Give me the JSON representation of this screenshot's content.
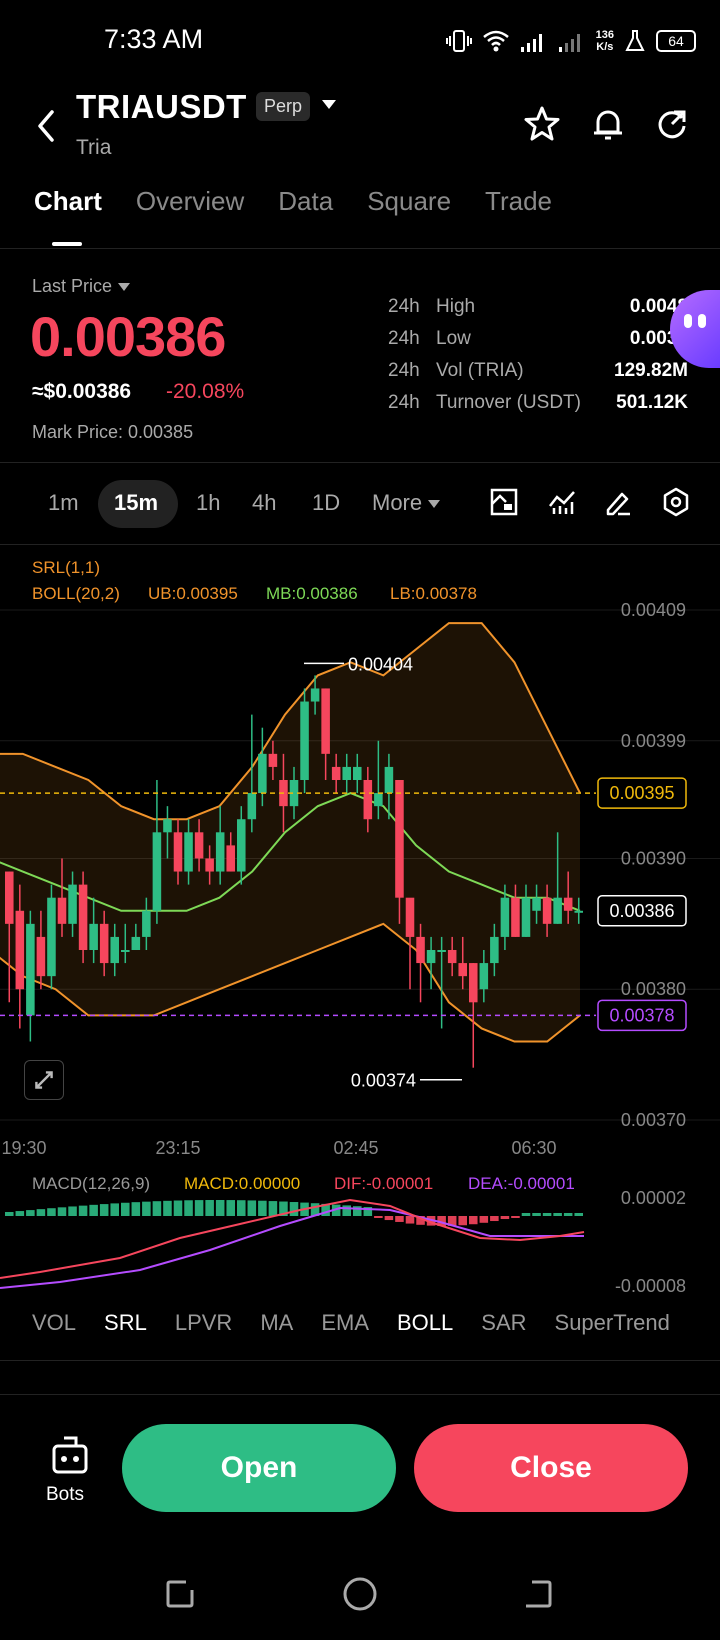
{
  "status": {
    "time": "7:33 AM",
    "net_speed_value": "136",
    "net_speed_unit": "K/s",
    "battery": "64"
  },
  "header": {
    "symbol": "TRIAUSDT",
    "badge": "Perp",
    "name": "Tria"
  },
  "tabs": [
    "Chart",
    "Overview",
    "Data",
    "Square",
    "Trade"
  ],
  "price": {
    "label": "Last Price",
    "last": "0.00386",
    "usd": "≈$0.00386",
    "change": "-20.08%",
    "mark": "Mark Price: 0.00385"
  },
  "stats": [
    {
      "period": "24h",
      "label": "High",
      "value": "0.0048"
    },
    {
      "period": "24h",
      "label": "Low",
      "value": "0.0037"
    },
    {
      "period": "24h",
      "label": "Vol (TRIA)",
      "value": "129.82M"
    },
    {
      "period": "24h",
      "label": "Turnover (USDT)",
      "value": "501.12K"
    }
  ],
  "timeframes": [
    "1m",
    "15m",
    "1h",
    "4h",
    "1D",
    "More"
  ],
  "indicators": {
    "srl": "SRL(1,1)",
    "boll": "BOLL(20,2)",
    "ub": "UB:0.00395",
    "mb": "MB:0.00386",
    "lb": "LB:0.00378",
    "macd_title": "MACD(12,26,9)",
    "macd_val": "MACD:0.00000",
    "dif": "DIF:-0.00001",
    "dea": "DEA:-0.00001"
  },
  "chart_data": {
    "type": "candlestick",
    "y_ticks": [
      "0.00409",
      "0.00399",
      "0.00390",
      "0.00380",
      "0.00370"
    ],
    "x_ticks": [
      "19:30",
      "23:15",
      "02:45",
      "06:30"
    ],
    "high_label": "0.00404",
    "low_label": "0.00374",
    "ub_tag": "0.00395",
    "current_tag": "0.00386",
    "lb_tag": "0.00378",
    "macd_ticks": [
      "0.00002",
      "-0.00008"
    ],
    "candles": [
      [
        0.00389,
        0.00385,
        0.00389,
        0.00379
      ],
      [
        0.00386,
        0.0038,
        0.00388,
        0.00377
      ],
      [
        0.00378,
        0.00385,
        0.00386,
        0.00376
      ],
      [
        0.00384,
        0.00381,
        0.00386,
        0.0038
      ],
      [
        0.00381,
        0.00387,
        0.00388,
        0.0038
      ],
      [
        0.00387,
        0.00385,
        0.0039,
        0.00384
      ],
      [
        0.00385,
        0.00388,
        0.00389,
        0.00384
      ],
      [
        0.00388,
        0.00383,
        0.00389,
        0.00382
      ],
      [
        0.00383,
        0.00385,
        0.00387,
        0.00382
      ],
      [
        0.00385,
        0.00382,
        0.00386,
        0.00381
      ],
      [
        0.00382,
        0.00384,
        0.00385,
        0.00381
      ],
      [
        0.00383,
        0.00383,
        0.00385,
        0.00382
      ],
      [
        0.00383,
        0.00384,
        0.00385,
        0.00383
      ],
      [
        0.00384,
        0.00386,
        0.00387,
        0.00383
      ],
      [
        0.00386,
        0.00392,
        0.00396,
        0.00385
      ],
      [
        0.00392,
        0.00393,
        0.00394,
        0.0039
      ],
      [
        0.00392,
        0.00389,
        0.00393,
        0.00388
      ],
      [
        0.00389,
        0.00392,
        0.00393,
        0.00388
      ],
      [
        0.00392,
        0.0039,
        0.00393,
        0.00389
      ],
      [
        0.0039,
        0.00389,
        0.00391,
        0.00388
      ],
      [
        0.00389,
        0.00392,
        0.00394,
        0.00388
      ],
      [
        0.00391,
        0.00389,
        0.00392,
        0.00389
      ],
      [
        0.00389,
        0.00393,
        0.00394,
        0.00388
      ],
      [
        0.00393,
        0.00395,
        0.00401,
        0.00392
      ],
      [
        0.00395,
        0.00398,
        0.004,
        0.00394
      ],
      [
        0.00398,
        0.00397,
        0.00399,
        0.00396
      ],
      [
        0.00396,
        0.00394,
        0.00398,
        0.00392
      ],
      [
        0.00394,
        0.00396,
        0.00397,
        0.00393
      ],
      [
        0.00396,
        0.00402,
        0.00403,
        0.00395
      ],
      [
        0.00402,
        0.00403,
        0.00404,
        0.00401
      ],
      [
        0.00403,
        0.00398,
        0.00403,
        0.00396
      ],
      [
        0.00397,
        0.00396,
        0.00398,
        0.00395
      ],
      [
        0.00396,
        0.00397,
        0.00398,
        0.00395
      ],
      [
        0.00396,
        0.00397,
        0.00398,
        0.00395
      ],
      [
        0.00396,
        0.00393,
        0.00397,
        0.00392
      ],
      [
        0.00394,
        0.00395,
        0.00399,
        0.00393
      ],
      [
        0.00395,
        0.00397,
        0.00398,
        0.00393
      ],
      [
        0.00396,
        0.00387,
        0.00396,
        0.00385
      ],
      [
        0.00387,
        0.00384,
        0.00386,
        0.0038
      ],
      [
        0.00384,
        0.00382,
        0.00385,
        0.00379
      ],
      [
        0.00382,
        0.00383,
        0.00384,
        0.0038
      ],
      [
        0.00383,
        0.00383,
        0.00384,
        0.00377
      ],
      [
        0.00383,
        0.00382,
        0.00384,
        0.00381
      ],
      [
        0.00382,
        0.00381,
        0.00384,
        0.0038
      ],
      [
        0.00382,
        0.00379,
        0.00382,
        0.00374
      ],
      [
        0.0038,
        0.00382,
        0.00383,
        0.00379
      ],
      [
        0.00382,
        0.00384,
        0.00385,
        0.00381
      ],
      [
        0.00384,
        0.00387,
        0.00388,
        0.00383
      ],
      [
        0.00387,
        0.00384,
        0.00388,
        0.00384
      ],
      [
        0.00384,
        0.00387,
        0.00388,
        0.00384
      ],
      [
        0.00386,
        0.00387,
        0.00388,
        0.00385
      ],
      [
        0.00387,
        0.00385,
        0.00388,
        0.00384
      ],
      [
        0.00385,
        0.00387,
        0.00392,
        0.00385
      ],
      [
        0.00387,
        0.00386,
        0.00389,
        0.00385
      ],
      [
        0.00386,
        0.00386,
        0.00387,
        0.00385
      ]
    ],
    "bollinger": {
      "ub": [
        0.00398,
        0.00398,
        0.00397,
        0.00396,
        0.00394,
        0.00393,
        0.00393,
        0.00394,
        0.00397,
        0.00401,
        0.00404,
        0.00405,
        0.00404,
        0.00406,
        0.00408,
        0.00408,
        0.00405,
        0.004,
        0.00395
      ],
      "mb": [
        0.0039,
        0.00389,
        0.00388,
        0.00387,
        0.00386,
        0.00386,
        0.00386,
        0.00387,
        0.00389,
        0.00392,
        0.00394,
        0.00395,
        0.00394,
        0.00391,
        0.00389,
        0.00388,
        0.00387,
        0.00387,
        0.00386
      ],
      "lb": [
        0.00383,
        0.00381,
        0.0038,
        0.00378,
        0.00378,
        0.00378,
        0.00379,
        0.0038,
        0.00381,
        0.00382,
        0.00383,
        0.00384,
        0.00385,
        0.00383,
        0.00379,
        0.00377,
        0.00376,
        0.00376,
        0.00378
      ]
    }
  },
  "indicator_tabs": [
    "VOL",
    "SRL",
    "LPVR",
    "MA",
    "EMA",
    "BOLL",
    "SAR",
    "SuperTrend"
  ],
  "buttons": {
    "bots": "Bots",
    "open": "Open",
    "close": "Close"
  },
  "colors": {
    "up": "#2ebd85",
    "down": "#f6465d",
    "ub": "#f0932b",
    "mb": "#7ed957",
    "lb": "#f0932b",
    "dif": "#f6465d",
    "dea": "#b44cff"
  }
}
